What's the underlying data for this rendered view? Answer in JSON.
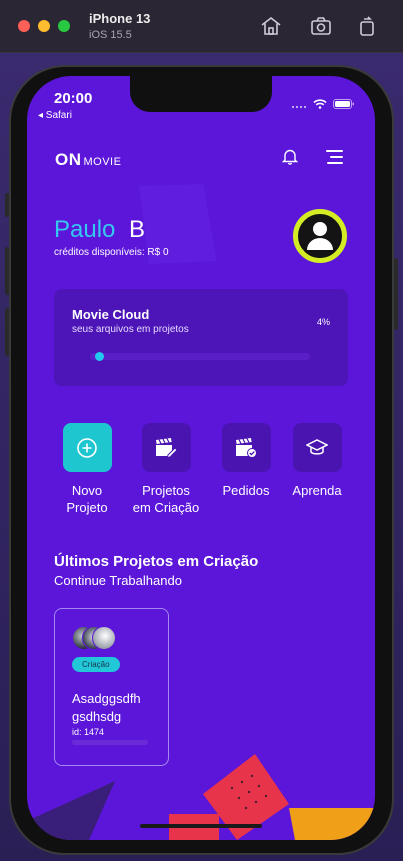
{
  "simulator": {
    "device": "iPhone 13",
    "os": "iOS 15.5",
    "icons": [
      "home-icon",
      "screenshot-icon",
      "rotate-icon"
    ]
  },
  "status_bar": {
    "time": "20:00",
    "back_label": "◂ Safari"
  },
  "header": {
    "logo_on": "ON",
    "logo_movie": "MOVIE",
    "icons": [
      "bell-icon",
      "menu-icon"
    ]
  },
  "user": {
    "first_name": "Paulo",
    "last_name": "B",
    "credits": "créditos disponíveis: R$ 0"
  },
  "cloud": {
    "title": "Movie Cloud",
    "subtitle": "seus arquivos em projetos",
    "percent_label": "4%",
    "progress": 0.04
  },
  "actions": [
    {
      "label_line1": "Novo",
      "label_line2": "Projeto",
      "icon": "plus-circle-icon"
    },
    {
      "label_line1": "Projetos",
      "label_line2": "em Criação",
      "icon": "clapperboard-edit-icon"
    },
    {
      "label_line1": "Pedidos",
      "label_line2": "",
      "icon": "clapperboard-check-icon"
    },
    {
      "label_line1": "Aprenda",
      "label_line2": "",
      "icon": "graduation-cap-icon"
    }
  ],
  "recent": {
    "title": "Últimos Projetos em Criação",
    "subtitle": "Continue Trabalhando",
    "projects": [
      {
        "badge": "Criação",
        "name_line1": "Asadggsdfh",
        "name_line2": "gsdhsdg",
        "id": "id: 1474"
      }
    ]
  },
  "colors": {
    "background": "#5b16d9",
    "card": "#4d14b8",
    "accent_cyan": "#22c8ee",
    "avatar_ring": "#d4ec24",
    "primary_button": "#1ec6cf",
    "secondary_button": "#4a14b0"
  }
}
